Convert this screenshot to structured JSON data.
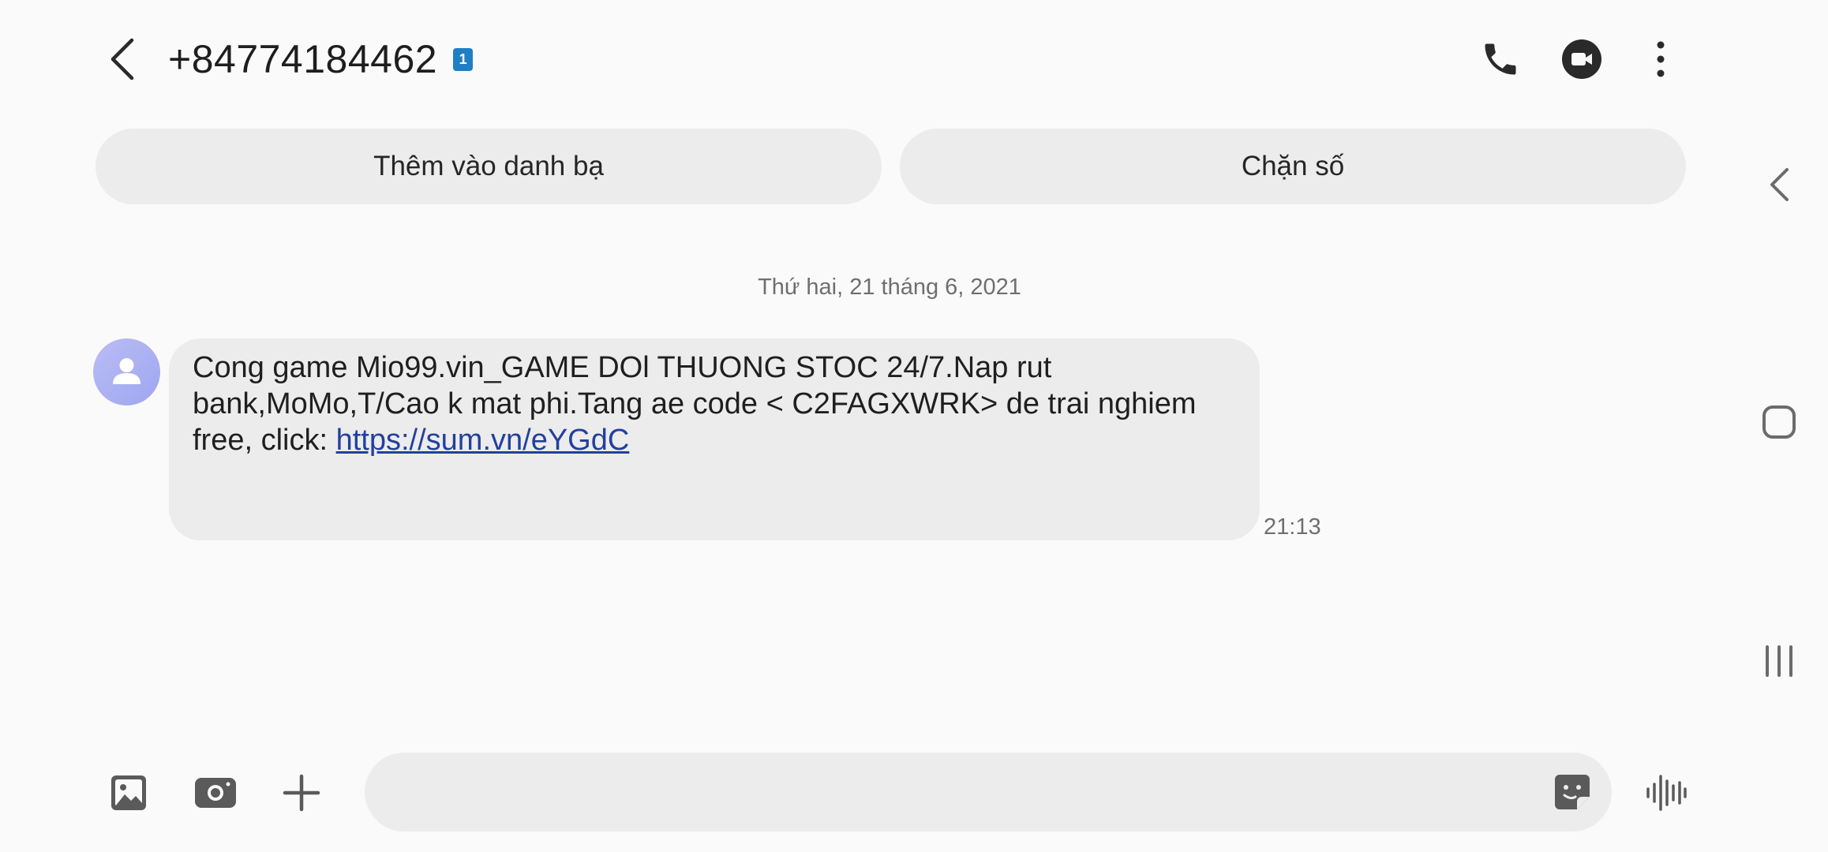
{
  "header": {
    "contact_number": "+84774184462",
    "sim_badge": "1",
    "icons": {
      "back": "back-arrow-icon",
      "call": "phone-icon",
      "video": "video-call-icon",
      "more": "more-options-icon"
    }
  },
  "actions": {
    "add_contact_label": "Thêm vào danh bạ",
    "block_label": "Chặn số"
  },
  "conversation": {
    "date_divider": "Thứ hai, 21 tháng 6, 2021",
    "messages": [
      {
        "text_part1": "Cong game Mio99.vin_GAME DOl THUONG STOC 24/7.Nap rut bank,MoMo,T/Cao k mat phi.Tang ae code < C2FAGXWRK> de trai nghiem free, click: ",
        "link": "https://sum.vn/eYGdC",
        "time": "21:13"
      }
    ]
  },
  "composer": {
    "input_value": "",
    "input_placeholder": "",
    "icons": {
      "gallery": "gallery-icon",
      "camera": "camera-icon",
      "attach": "plus-icon",
      "sticker": "sticker-icon",
      "voice": "voice-record-icon"
    }
  },
  "colors": {
    "background": "#fafafa",
    "bubble": "#ececec",
    "link": "#23409e",
    "sim_badge": "#1f7fc4",
    "avatar": "#a5acf2"
  }
}
